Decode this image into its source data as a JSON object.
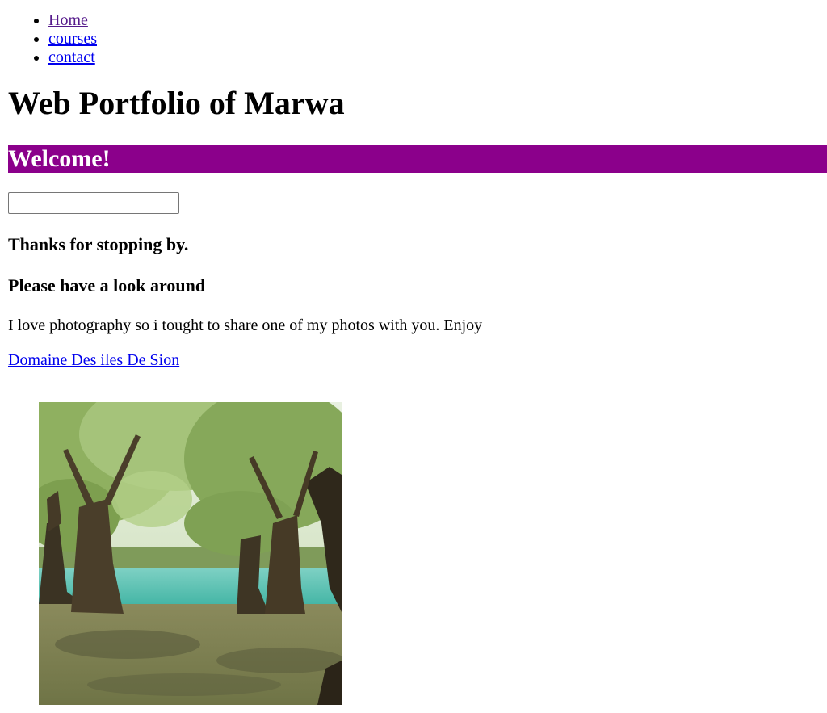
{
  "nav": {
    "items": [
      {
        "label": "Home",
        "visited": true
      },
      {
        "label": "courses",
        "visited": false
      },
      {
        "label": "contact",
        "visited": false
      }
    ]
  },
  "header": {
    "title": "Web Portfolio of Marwa"
  },
  "banner": {
    "text": "Welcome!",
    "color": "#8b008b"
  },
  "input": {
    "value": "",
    "placeholder": ""
  },
  "content": {
    "thanks": "Thanks for stopping by.",
    "look_around": "Please have a look around",
    "intro": "I love photography so i tought to share one of my photos with you. Enjoy",
    "photo_link": "Domaine Des iles De Sion"
  },
  "photo": {
    "icon": "landscape-photo-willow-trees-lake"
  }
}
